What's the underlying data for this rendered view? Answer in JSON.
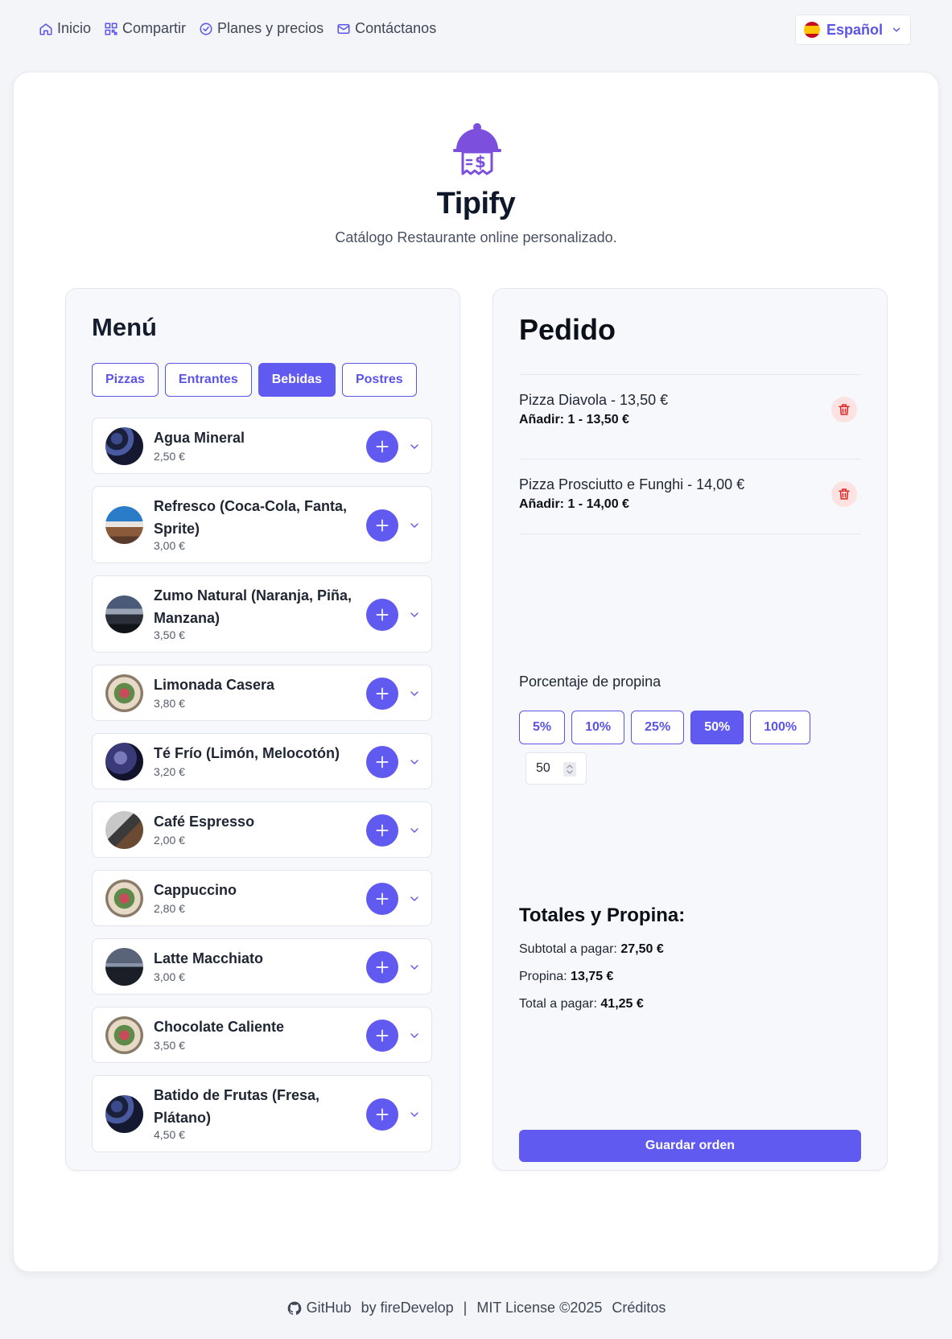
{
  "nav": {
    "items": [
      {
        "label": "Inicio",
        "icon": "home-icon"
      },
      {
        "label": "Compartir",
        "icon": "qr-icon"
      },
      {
        "label": "Planes y precios",
        "icon": "check-circle-icon"
      },
      {
        "label": "Contáctanos",
        "icon": "mail-icon"
      }
    ],
    "language": "Español"
  },
  "header": {
    "title": "Tipify",
    "subtitle": "Catálogo Restaurante online personalizado."
  },
  "menu": {
    "title": "Menú",
    "tabs": [
      "Pizzas",
      "Entrantes",
      "Bebidas",
      "Postres"
    ],
    "active_tab": "Bebidas",
    "items": [
      {
        "name": "Agua Mineral",
        "price": "2,50 €"
      },
      {
        "name": "Refresco (Coca-Cola, Fanta, Sprite)",
        "price": "3,00 €"
      },
      {
        "name": "Zumo Natural (Naranja, Piña, Manzana)",
        "price": "3,50 €"
      },
      {
        "name": "Limonada Casera",
        "price": "3,80 €"
      },
      {
        "name": "Té Frío (Limón, Melocotón)",
        "price": "3,20 €"
      },
      {
        "name": "Café Espresso",
        "price": "2,00 €"
      },
      {
        "name": "Cappuccino",
        "price": "2,80 €"
      },
      {
        "name": "Latte Macchiato",
        "price": "3,00 €"
      },
      {
        "name": "Chocolate Caliente",
        "price": "3,50 €"
      },
      {
        "name": "Batido de Frutas (Fresa, Plátano)",
        "price": "4,50 €"
      }
    ]
  },
  "order": {
    "title": "Pedido",
    "lines": [
      {
        "name": "Pizza Diavola - 13,50 €",
        "detail": "Añadir: 1 - 13,50 €"
      },
      {
        "name": "Pizza Prosciutto e Funghi - 14,00 €",
        "detail": "Añadir: 1 - 14,00 €"
      }
    ],
    "tip_label": "Porcentaje de propina",
    "tip_options": [
      "5%",
      "10%",
      "25%",
      "50%",
      "100%"
    ],
    "tip_selected": "50%",
    "tip_value": "50",
    "totals_title": "Totales y Propina:",
    "subtotal_label": "Subtotal a pagar:",
    "subtotal_value": "27,50 €",
    "tip_total_label": "Propina:",
    "tip_total_value": "13,75 €",
    "total_label": "Total a pagar:",
    "total_value": "41,25 €",
    "save_label": "Guardar orden"
  },
  "footer": {
    "github": "GitHub",
    "by": "by fireDevelop",
    "separator": "|",
    "license": "MIT License ©2025",
    "credits": "Créditos"
  },
  "colors": {
    "accent": "#615af0",
    "background": "#f3f5f9",
    "danger_bg": "#fde2e2",
    "danger": "#dc2626"
  }
}
